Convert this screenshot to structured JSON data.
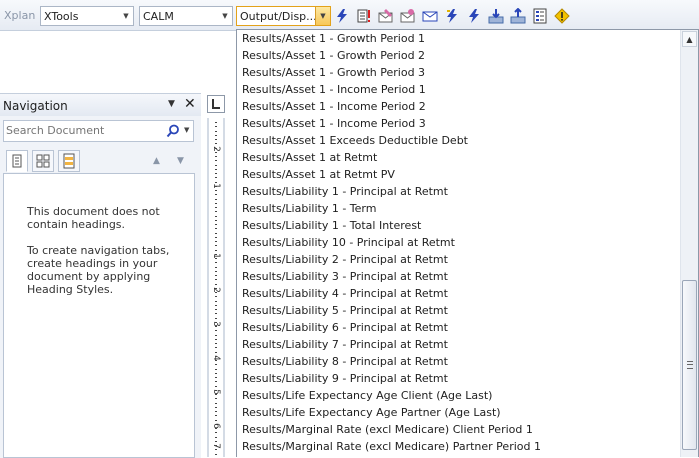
{
  "toolbar": {
    "label": "Xplan",
    "combo1": "XTools",
    "combo2": "CALM",
    "combo3": "Output/Disp...",
    "icons": [
      "lightning-icon",
      "document-alert-icon",
      "envelope-pencil-icon",
      "envelope-send-icon",
      "envelope-icon",
      "lightning-icon",
      "lightning-icon",
      "arrow-down-icon",
      "arrow-up-icon",
      "checklist-icon",
      "warning-icon"
    ]
  },
  "navigation": {
    "title": "Navigation",
    "search_placeholder": "Search Document",
    "message1": "This document does not contain headings.",
    "message2": "To create navigation tabs, create headings in your document by applying Heading Styles."
  },
  "ruler": {
    "numbers": [
      "2",
      "1",
      "1",
      "2",
      "3",
      "4",
      "5",
      "6",
      "7"
    ]
  },
  "dropdown": {
    "items": [
      "Results/Asset 1 - Growth Period 1",
      "Results/Asset 1 - Growth Period 2",
      "Results/Asset 1 - Growth Period 3",
      "Results/Asset 1 - Income Period 1",
      "Results/Asset 1 - Income Period 2",
      "Results/Asset 1 - Income Period 3",
      "Results/Asset 1 Exceeds Deductible Debt",
      "Results/Asset 1 at Retmt",
      "Results/Asset 1 at Retmt PV",
      "Results/Liability 1 - Principal at Retmt",
      "Results/Liability 1 - Term",
      "Results/Liability 1 - Total Interest",
      "Results/Liability 10 - Principal at Retmt",
      "Results/Liability 2 - Principal at Retmt",
      "Results/Liability 3 - Principal at Retmt",
      "Results/Liability 4 - Principal at Retmt",
      "Results/Liability 5 - Principal at Retmt",
      "Results/Liability 6 - Principal at Retmt",
      "Results/Liability 7 - Principal at Retmt",
      "Results/Liability 8 - Principal at Retmt",
      "Results/Liability 9 - Principal at Retmt",
      "Results/Life Expectancy Age Client (Age Last)",
      "Results/Life Expectancy Age Partner (Age Last)",
      "Results/Marginal Rate (excl Medicare) Client Period 1",
      "Results/Marginal Rate (excl Medicare) Partner Period 1"
    ]
  }
}
